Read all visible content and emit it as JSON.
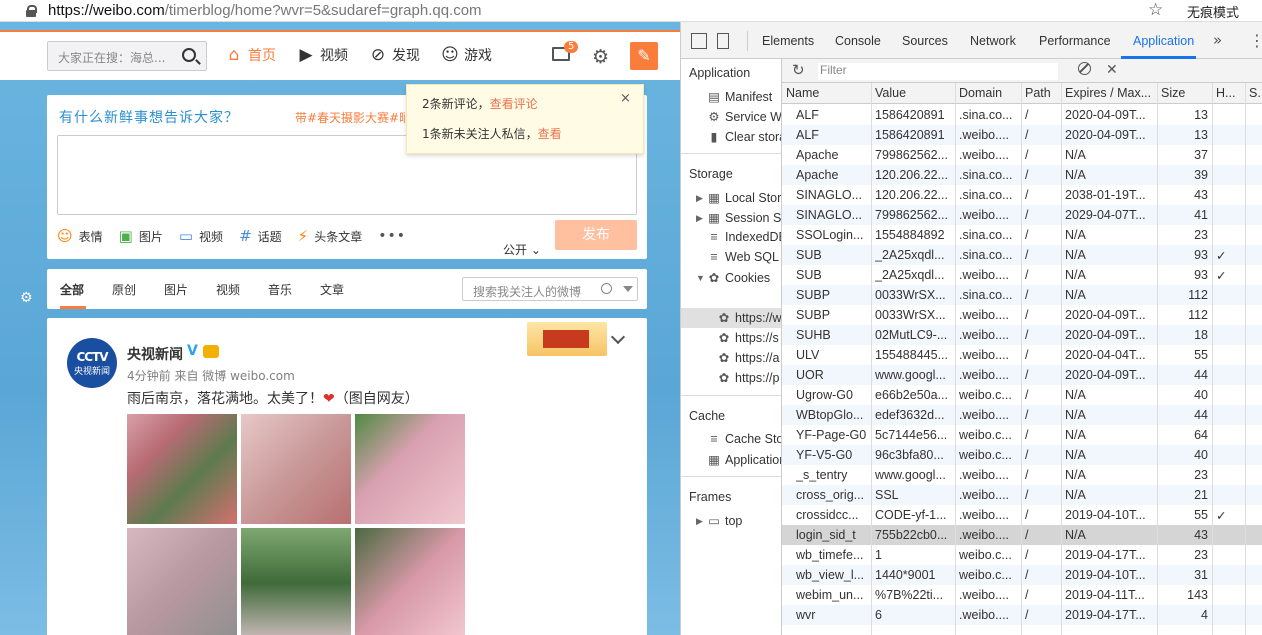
{
  "browser": {
    "url_host": "https://weibo.com",
    "url_path": "/timerblog/home?wvr=5&sudaref=graph.qq.com",
    "incognito_label": "无痕模式"
  },
  "weibo": {
    "search_placeholder": "大家正在搜：海总...",
    "nav": [
      {
        "label": "首页",
        "icon": "home-icon"
      },
      {
        "label": "视频",
        "icon": "video-icon"
      },
      {
        "label": "发现",
        "icon": "compass-icon"
      },
      {
        "label": "游戏",
        "icon": "gamepad-icon"
      }
    ],
    "mail_badge": "5",
    "slogan": "有什么新鲜事想告诉大家？",
    "hot_topic": "带#春天摄影大赛#晒",
    "toolbar": [
      {
        "label": "表情",
        "icon": "emoji-icon"
      },
      {
        "label": "图片",
        "icon": "image-icon"
      },
      {
        "label": "视频",
        "icon": "video-camera-icon"
      },
      {
        "label": "话题",
        "icon": "hashtag-icon"
      },
      {
        "label": "头条文章",
        "icon": "lightning-icon"
      }
    ],
    "more": "•••",
    "visibility": "公开",
    "publish": "发布",
    "notice": {
      "line1_text": "2条新评论，",
      "line1_link": "查看评论",
      "line2_text": "1条新未关注人私信，",
      "line2_link": "查看",
      "close": "×"
    },
    "tabs": [
      "全部",
      "原创",
      "图片",
      "视频",
      "音乐",
      "文章"
    ],
    "feed_search_placeholder": "搜索我关注人的微博",
    "post": {
      "avatar_line1": "CCTV",
      "avatar_line2": "央视新闻",
      "user": "央视新闻",
      "meta": "4分钟前 来自 微博 weibo.com",
      "text": "雨后南京，落花满地。太美了！",
      "text_after": "（图自网友）"
    }
  },
  "devtools": {
    "tabs": [
      "Elements",
      "Console",
      "Sources",
      "Network",
      "Performance",
      "Application"
    ],
    "active_tab": "Application",
    "filter_placeholder": "Filter",
    "sidebar": {
      "application_header": "Application",
      "application_items": [
        "Manifest",
        "Service Wo",
        "Clear stora"
      ],
      "storage_header": "Storage",
      "storage_items": [
        "Local Stora",
        "Session St",
        "IndexedDE",
        "Web SQL",
        "Cookies"
      ],
      "cookie_items": [
        "https://w",
        "https://s",
        "https://a",
        "https://p"
      ],
      "cache_header": "Cache",
      "cache_items": [
        "Cache Sto",
        "Application"
      ],
      "frames_header": "Frames",
      "frames_items": [
        "top"
      ]
    },
    "columns": [
      "Name",
      "Value",
      "Domain",
      "Path",
      "Expires / Max...",
      "Size",
      "H...",
      "S."
    ],
    "rows": [
      [
        "ALF",
        "1586420891",
        ".sina.co...",
        "/",
        "2020-04-09T...",
        "13",
        ""
      ],
      [
        "ALF",
        "1586420891",
        ".weibo....",
        "/",
        "2020-04-09T...",
        "13",
        ""
      ],
      [
        "Apache",
        "799862562...",
        ".weibo....",
        "/",
        "N/A",
        "37",
        ""
      ],
      [
        "Apache",
        "120.206.22...",
        ".sina.co...",
        "/",
        "N/A",
        "39",
        ""
      ],
      [
        "SINAGLO...",
        "120.206.22...",
        ".sina.co...",
        "/",
        "2038-01-19T...",
        "43",
        ""
      ],
      [
        "SINAGLO...",
        "799862562...",
        ".weibo....",
        "/",
        "2029-04-07T...",
        "41",
        ""
      ],
      [
        "SSOLogin...",
        "1554884892",
        ".sina.co...",
        "/",
        "N/A",
        "23",
        ""
      ],
      [
        "SUB",
        "_2A25xqdl...",
        ".sina.co...",
        "/",
        "N/A",
        "93",
        "✓"
      ],
      [
        "SUB",
        "_2A25xqdl...",
        ".weibo....",
        "/",
        "N/A",
        "93",
        "✓"
      ],
      [
        "SUBP",
        "0033WrSX...",
        ".sina.co...",
        "/",
        "N/A",
        "112",
        ""
      ],
      [
        "SUBP",
        "0033WrSX...",
        ".weibo....",
        "/",
        "2020-04-09T...",
        "112",
        ""
      ],
      [
        "SUHB",
        "02MutLC9-...",
        ".weibo....",
        "/",
        "2020-04-09T...",
        "18",
        ""
      ],
      [
        "ULV",
        "155488445...",
        ".weibo....",
        "/",
        "2020-04-04T...",
        "55",
        ""
      ],
      [
        "UOR",
        "www.googl...",
        ".weibo....",
        "/",
        "2020-04-09T...",
        "44",
        ""
      ],
      [
        "Ugrow-G0",
        "e66b2e50a...",
        "weibo.c...",
        "/",
        "N/A",
        "40",
        ""
      ],
      [
        "WBtopGlo...",
        "edef3632d...",
        ".weibo....",
        "/",
        "N/A",
        "44",
        ""
      ],
      [
        "YF-Page-G0",
        "5c7144e56...",
        "weibo.c...",
        "/",
        "N/A",
        "64",
        ""
      ],
      [
        "YF-V5-G0",
        "96c3bfa80...",
        "weibo.c...",
        "/",
        "N/A",
        "40",
        ""
      ],
      [
        "_s_tentry",
        "www.googl...",
        ".weibo....",
        "/",
        "N/A",
        "23",
        ""
      ],
      [
        "cross_orig...",
        "SSL",
        ".weibo....",
        "/",
        "N/A",
        "21",
        ""
      ],
      [
        "crossidcc...",
        "CODE-yf-1...",
        ".weibo....",
        "/",
        "2019-04-10T...",
        "55",
        "✓"
      ],
      [
        "login_sid_t",
        "755b22cb0...",
        ".weibo....",
        "/",
        "N/A",
        "43",
        ""
      ],
      [
        "wb_timefe...",
        "1",
        "weibo.c...",
        "/",
        "2019-04-17T...",
        "23",
        ""
      ],
      [
        "wb_view_l...",
        "1440*9001",
        "weibo.c...",
        "/",
        "2019-04-10T...",
        "31",
        ""
      ],
      [
        "webim_un...",
        "%7B%22ti...",
        ".weibo....",
        "/",
        "2019-04-11T...",
        "143",
        ""
      ],
      [
        "wvr",
        "6",
        ".weibo....",
        "/",
        "2019-04-17T...",
        "4",
        ""
      ]
    ],
    "selected_row": 21
  }
}
